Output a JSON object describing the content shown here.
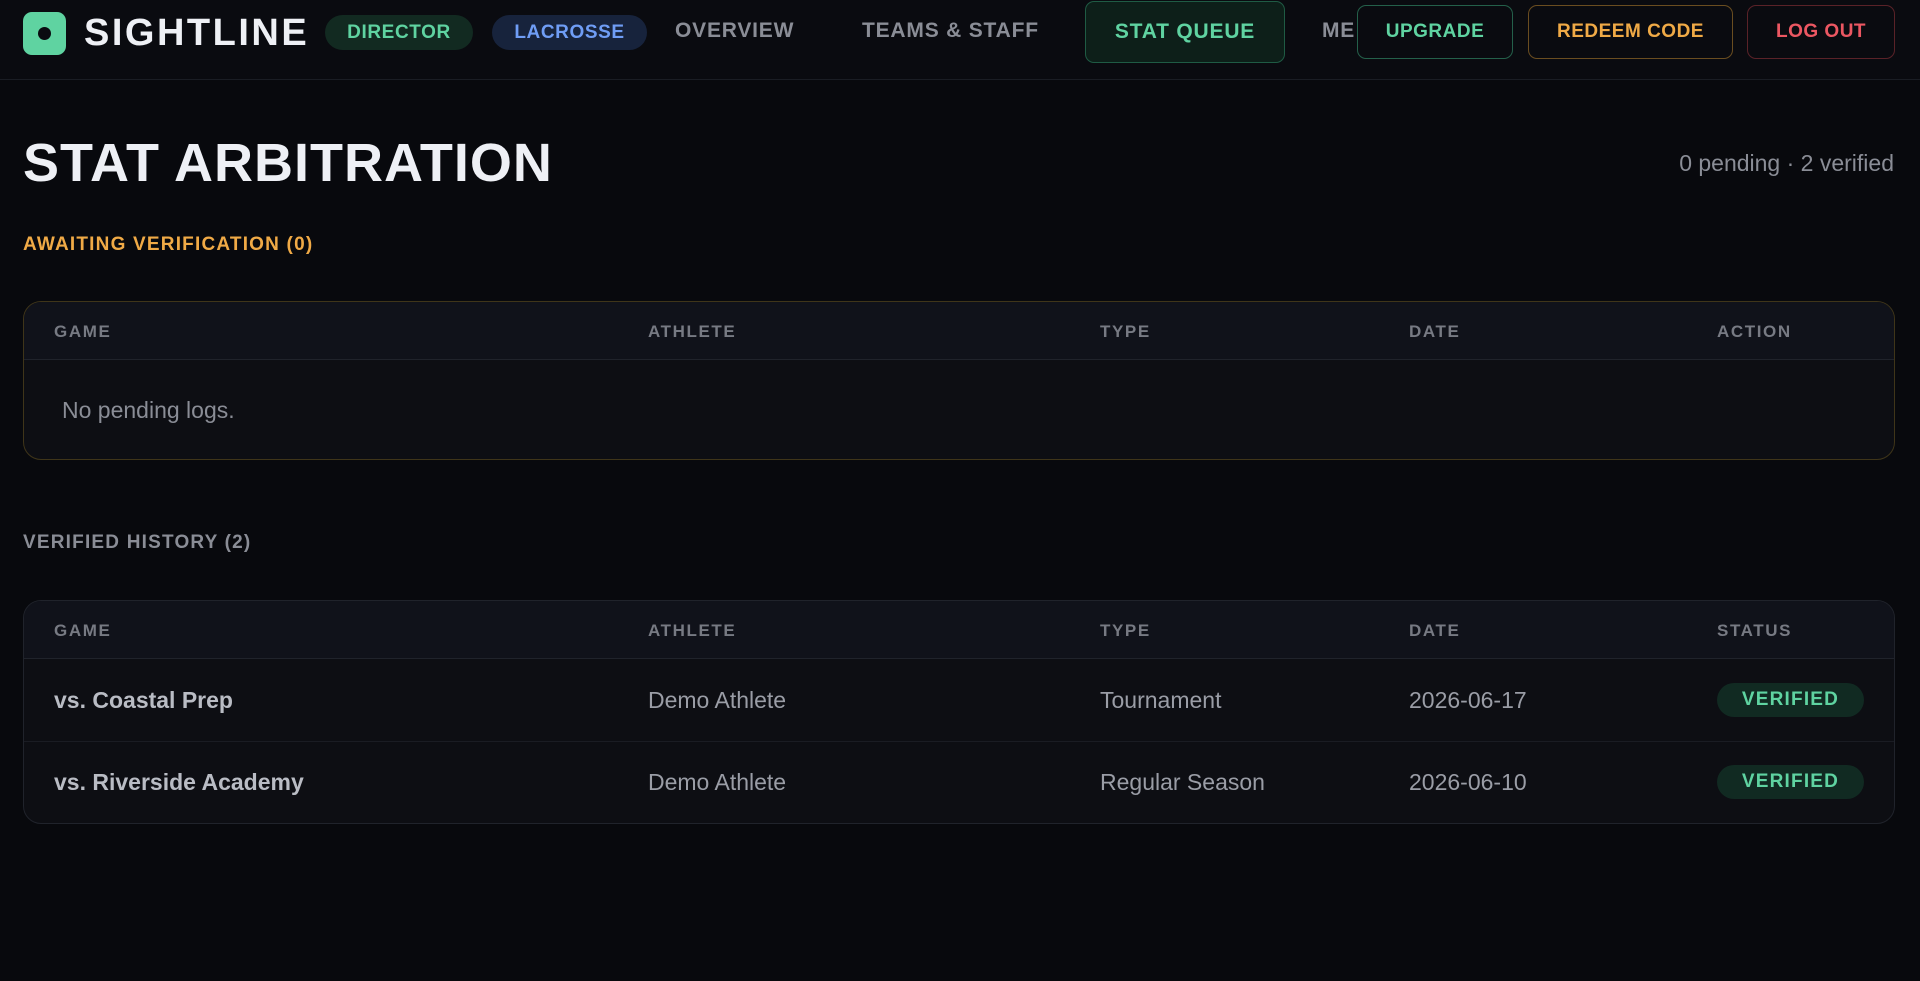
{
  "brand": {
    "name": "SIGHTLINE",
    "logo_icon": "logo-dot-icon",
    "accent": "#5fd3a1"
  },
  "nav": {
    "role_pill": "DIRECTOR",
    "sport_pill": "LACROSSE",
    "links": {
      "overview": "OVERVIEW",
      "teams": "TEAMS & STAFF",
      "stat_queue": "STAT QUEUE",
      "more": "MES"
    }
  },
  "actions": {
    "upgrade": "UPGRADE",
    "redeem": "REDEEM CODE",
    "logout": "LOG OUT"
  },
  "page": {
    "title": "STAT ARBITRATION",
    "summary": "0 pending · 2 verified"
  },
  "pending": {
    "label": "AWAITING VERIFICATION (0)",
    "columns": [
      "GAME",
      "ATHLETE",
      "TYPE",
      "DATE",
      "ACTION"
    ],
    "empty_text": "No pending logs."
  },
  "history": {
    "label": "VERIFIED HISTORY (2)",
    "columns": [
      "GAME",
      "ATHLETE",
      "TYPE",
      "DATE",
      "STATUS"
    ],
    "rows": [
      {
        "game": "vs. Coastal Prep",
        "athlete": "Demo Athlete",
        "type": "Tournament",
        "date": "2026-06-17",
        "status": "VERIFIED"
      },
      {
        "game": "vs. Riverside Academy",
        "athlete": "Demo Athlete",
        "type": "Regular Season",
        "date": "2026-06-10",
        "status": "VERIFIED"
      }
    ]
  },
  "colors": {
    "background": "#08090d",
    "green": "#5fd3a1",
    "blue": "#6f9df5",
    "amber": "#f0aa46",
    "red": "#ec5762"
  }
}
